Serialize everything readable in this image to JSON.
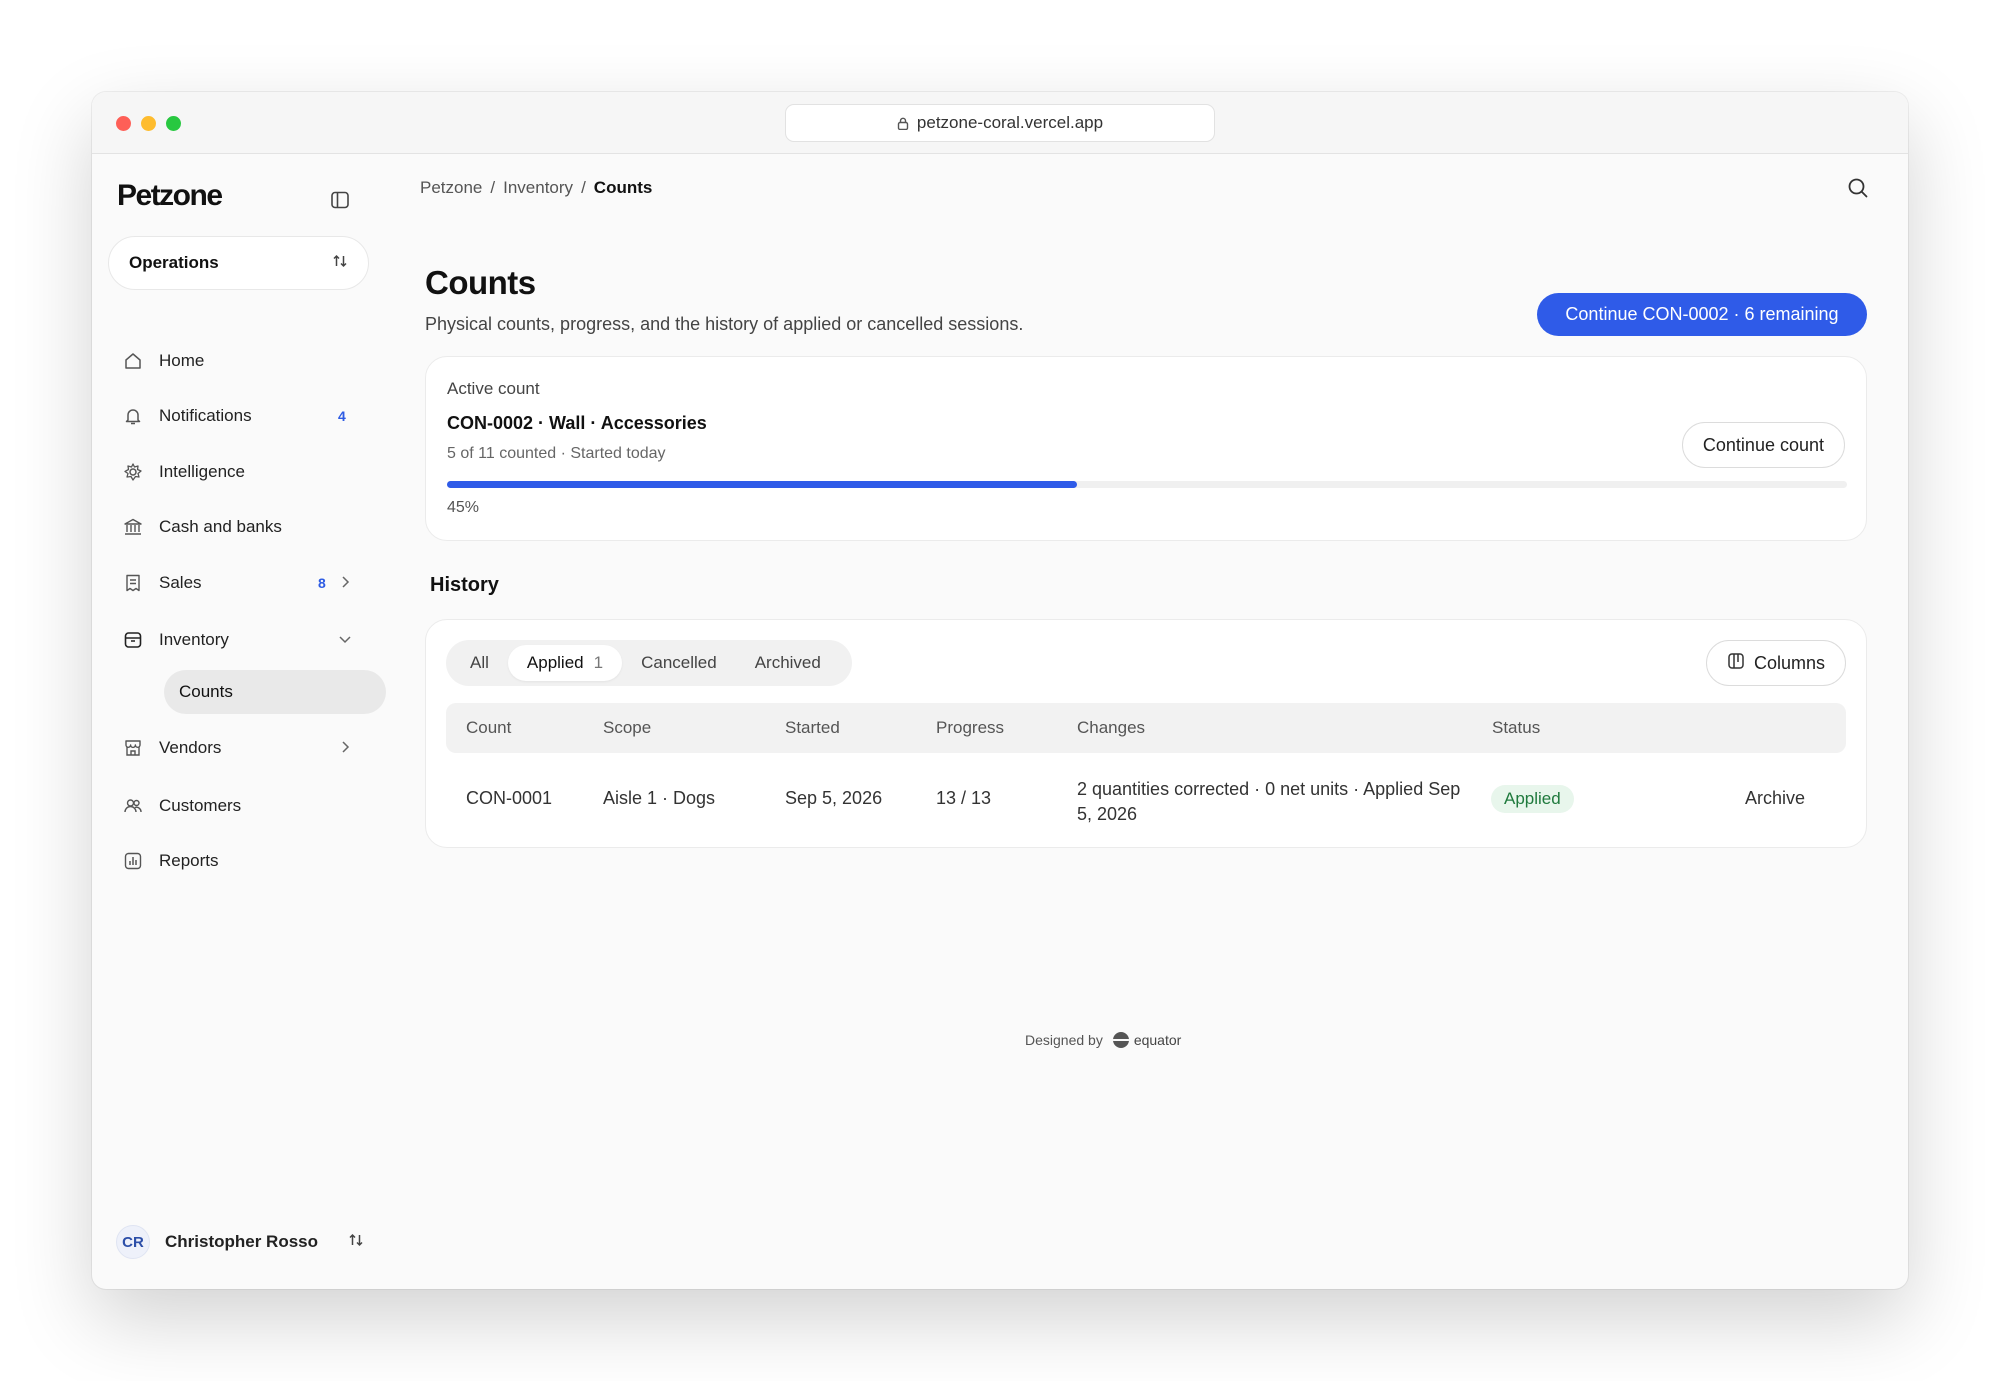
{
  "browser": {
    "url": "petzone-coral.vercel.app"
  },
  "sidebar": {
    "logo": "Petzone",
    "workspace": "Operations",
    "items": [
      {
        "label": "Home",
        "icon": "home-icon"
      },
      {
        "label": "Notifications",
        "icon": "bell-icon",
        "badge": "4"
      },
      {
        "label": "Intelligence",
        "icon": "sparkle-gear-icon"
      },
      {
        "label": "Cash and banks",
        "icon": "bank-icon"
      },
      {
        "label": "Sales",
        "icon": "receipt-icon",
        "badge": "8"
      },
      {
        "label": "Inventory",
        "icon": "box-icon"
      },
      {
        "label": "Vendors",
        "icon": "store-icon"
      },
      {
        "label": "Customers",
        "icon": "users-icon"
      },
      {
        "label": "Reports",
        "icon": "chart-icon"
      }
    ],
    "sub_item": "Counts",
    "user": {
      "initials": "CR",
      "name": "Christopher Rosso"
    }
  },
  "breadcrumb": {
    "root": "Petzone",
    "section": "Inventory",
    "current": "Counts",
    "sep": "/"
  },
  "page": {
    "title": "Counts",
    "subtitle": "Physical counts, progress, and the history of applied or cancelled sessions.",
    "primary_action": "Continue CON-0002 · 6 remaining"
  },
  "active_count": {
    "label": "Active count",
    "title": "CON-0002 · Wall · Accessories",
    "meta": "5 of 11 counted · Started today",
    "progress": 0.45,
    "progress_label": "45%",
    "action": "Continue count"
  },
  "history": {
    "title": "History",
    "tabs": [
      {
        "label": "All"
      },
      {
        "label": "Applied",
        "count": "1"
      },
      {
        "label": "Cancelled"
      },
      {
        "label": "Archived"
      }
    ],
    "columns_button": "Columns",
    "headers": [
      "Count",
      "Scope",
      "Started",
      "Progress",
      "Changes",
      "Status"
    ],
    "rows": [
      {
        "count": "CON-0001",
        "scope": "Aisle 1 · Dogs",
        "started": "Sep 5, 2026",
        "progress": "13 / 13",
        "changes": "2 quantities corrected · 0 net units · Applied Sep 5, 2026",
        "status": "Applied",
        "action": "Archive"
      }
    ]
  },
  "footer": {
    "designed_by": "Designed by",
    "brand": "equator"
  },
  "colors": {
    "accent": "#2f5be8",
    "success_bg": "#e8f6ec",
    "success_text": "#1f7a3d"
  }
}
